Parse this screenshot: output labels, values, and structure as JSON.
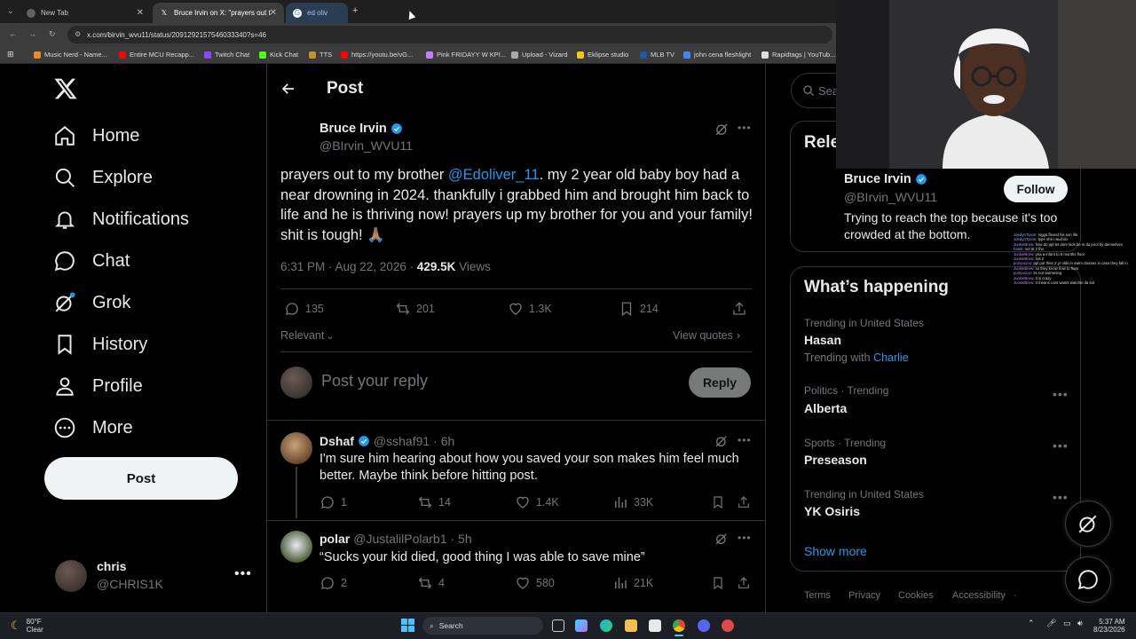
{
  "browser": {
    "tabs": [
      {
        "title": "New Tab"
      },
      {
        "title": "Bruce Irvin on X: \"prayers out t"
      },
      {
        "title": "ed oliv"
      }
    ],
    "url": "x.com/birvin_wvu11/status/2091292157546033340?s=46",
    "bookmarks": [
      "Music Nerd - Name...",
      "Entire MCU Recapp...",
      "Twitch Chat",
      "Kick Chat",
      "TTS",
      "https://youtu.be/vG...",
      "Pink FRIDAYY W KPI...",
      "Upload - Vizard",
      "Eklipse studio",
      "MLB TV",
      "john cena fleshlight",
      "Rapidtags | YouTub..."
    ]
  },
  "nav": {
    "items": [
      {
        "label": "Home",
        "icon": "home-icon"
      },
      {
        "label": "Explore",
        "icon": "search-icon"
      },
      {
        "label": "Notifications",
        "icon": "bell-icon"
      },
      {
        "label": "Chat",
        "icon": "chat-icon"
      },
      {
        "label": "Grok",
        "icon": "grok-icon"
      },
      {
        "label": "History",
        "icon": "bookmark-icon"
      },
      {
        "label": "Profile",
        "icon": "person-icon"
      },
      {
        "label": "More",
        "icon": "more-circle-icon"
      }
    ],
    "post_label": "Post",
    "user": {
      "name": "chris",
      "handle": "@CHRIS1K"
    }
  },
  "header": {
    "title": "Post"
  },
  "tweet": {
    "name": "Bruce Irvin",
    "handle": "@BIrvin_WVU11",
    "text_before": "prayers out to my brother ",
    "mention": "@Edoliver_11",
    "text_after": ". my 2 year old baby boy had a near drowning in 2024. thankfully i grabbed him and brought him back to life and he is thriving now! prayers up my brother for you and your family! shit is tough! 🙏🏽",
    "time": "6:31 PM · Aug 22, 2026 · ",
    "views": "429.5K",
    "views_label": " Views",
    "replies": "135",
    "reposts": "201",
    "likes": "1.3K",
    "bookmarks": "214",
    "sort_label": "Relevant",
    "view_quotes": "View quotes"
  },
  "reply_box": {
    "placeholder": "Post your reply",
    "button": "Reply"
  },
  "replies": [
    {
      "name": "Dshaf",
      "handle": "@sshaf91",
      "time": "· 6h",
      "text": "I'm sure him hearing about how you saved your son makes him feel much better. Maybe think before hitting post.",
      "replies": "1",
      "reposts": "14",
      "likes": "1.4K",
      "views": "33K"
    },
    {
      "name": "polar",
      "handle": "@JustalilPolarb1",
      "time": "· 5h",
      "text": "“Sucks your kid died, good thing I was able to save mine”",
      "replies": "2",
      "reposts": "4",
      "likes": "580",
      "views": "21K"
    }
  ],
  "right": {
    "search_placeholder": "Sea",
    "relevant_title": "Rele",
    "relevant_person": {
      "name": "Bruce Irvin",
      "handle": "@BIrvin_WVU11",
      "bio": "Trying to reach the top because it's too crowded at the bottom.",
      "follow": "Follow"
    },
    "happening_title": "What’s happening",
    "trends": [
      {
        "category": "Trending in United States",
        "name": "Hasan",
        "with_label": "Trending with",
        "with": "Charlie"
      },
      {
        "category": "Politics · Trending",
        "name": "Alberta"
      },
      {
        "category": "Sports · Trending",
        "name": "Preseason"
      },
      {
        "category": "Trending in United States",
        "name": "YK Osiris"
      }
    ],
    "show_more": "Show more",
    "footer": [
      "Terms",
      "Privacy",
      "Cookies",
      "Accessibility"
    ]
  },
  "chat_overlay": [
    {
      "user": "JoedynTyson",
      "msg": "nigga flexed his son life"
    },
    {
      "user": "JoedynTyson",
      "msg": "type shit i wud do"
    },
    {
      "user": "JunkieBrew",
      "msg": "how do ppl let dere kids be in da pool by demselves"
    },
    {
      "user": "hamli",
      "msg": "not at 2 tho"
    },
    {
      "user": "JunkieBrew",
      "msg": "yea a infant to 6 months floor"
    },
    {
      "user": "JunkieBrew",
      "msg": "not 2"
    },
    {
      "user": "pompuzoo",
      "msg": "ppl put their 2 yr olds in swim classes in case they fall in"
    },
    {
      "user": "JunkieBrew",
      "msg": "so they know how to float"
    },
    {
      "user": "pompuzoo",
      "msg": "its not swimming"
    },
    {
      "user": "JunkieBrew",
      "msg": "it is crazy"
    },
    {
      "user": "JunkieBrew",
      "msg": "it means cant wasnt watchin da kid"
    }
  ],
  "taskbar": {
    "weather_temp": "80°F",
    "weather_desc": "Clear",
    "search_label": "Search",
    "time": "5:37 AM",
    "date": "8/23/2026"
  },
  "colors": {
    "accent": "#1d9bf0",
    "muted": "#71767b",
    "bg": "#000000",
    "border": "#2f3336"
  }
}
